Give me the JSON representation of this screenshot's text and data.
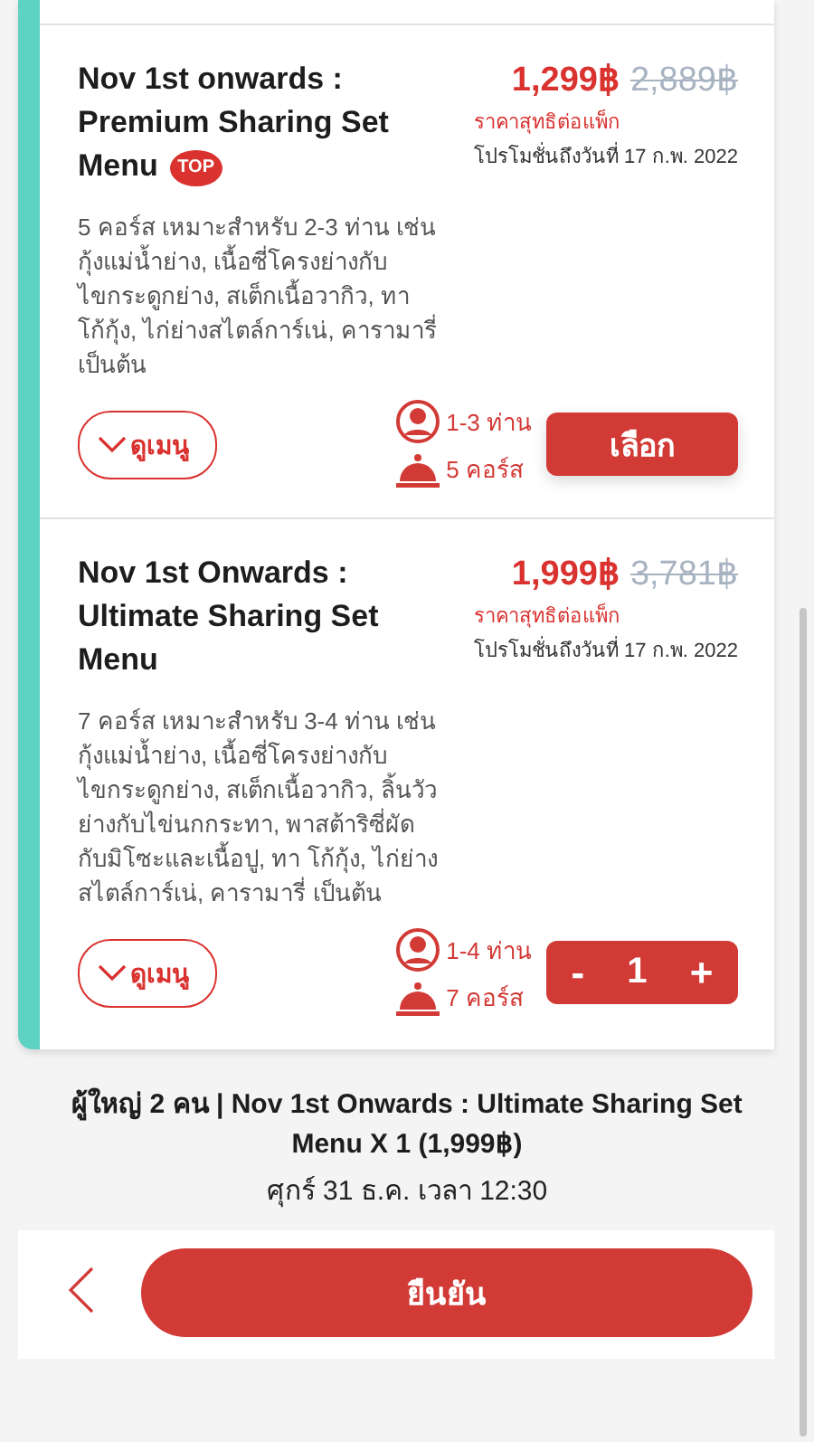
{
  "packages": [
    {
      "kind": "select",
      "title": "Nov 1st onwards : Premium Sharing Set Menu",
      "badge": "TOP",
      "price": "1,299฿",
      "old_price": "2,889฿",
      "price_note": "ราคาสุทธิต่อแพ็ก",
      "promo": "โปรโมชั่นถึงวันที่ 17 ก.พ. 2022",
      "description": "5 คอร์ส เหมาะสำหรับ 2-3 ท่าน เช่น กุ้งแม่น้ำย่าง, เนื้อซี่โครงย่างกับไขกระดูกย่าง, สเต็กเนื้อวากิว, ทา โก้กุ้ง, ไก่ย่างสไตล์การ์เน่, คารามารี่ เป็นต้น",
      "menu_button": "ดูเมนู",
      "guests": "1-3 ท่าน",
      "courses": "5 คอร์ส",
      "select_button": "เลือก"
    },
    {
      "kind": "stepper",
      "title": "Nov 1st Onwards : Ultimate Sharing Set Menu",
      "price": "1,999฿",
      "old_price": "3,781฿",
      "price_note": "ราคาสุทธิต่อแพ็ก",
      "promo": "โปรโมชั่นถึงวันที่ 17 ก.พ. 2022",
      "description": "7 คอร์ส เหมาะสำหรับ 3-4 ท่าน เช่น กุ้งแม่น้ำย่าง, เนื้อซี่โครงย่างกับไขกระดูกย่าง, สเต็กเนื้อวากิว, ลิ้นวัวย่างกับไข่นกกระทา, พาสต้าริซี่ผัดกับมิโซะและเนื้อปู, ทา โก้กุ้ง, ไก่ย่างสไตล์การ์เน่, คารามารี่ เป็นต้น",
      "menu_button": "ดูเมนู",
      "guests": "1-4 ท่าน",
      "courses": "7 คอร์ส",
      "minus": "-",
      "quantity": "1",
      "plus": "+"
    }
  ],
  "summary": {
    "line": "ผู้ใหญ่ 2 คน | Nov 1st Onwards : Ultimate Sharing Set Menu X 1 (1,999฿)",
    "datetime": "ศุกร์ 31 ธ.ค. เวลา 12:30"
  },
  "confirm_button": "ยืนยัน"
}
